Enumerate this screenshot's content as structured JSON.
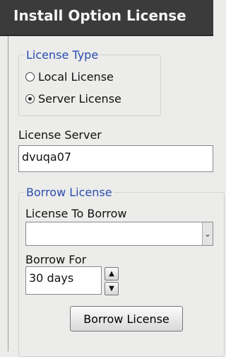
{
  "window": {
    "title": "Install Option License"
  },
  "license_type": {
    "legend": "License Type",
    "options": [
      {
        "label": "Local License",
        "selected": false
      },
      {
        "label": "Server License",
        "selected": true
      }
    ]
  },
  "license_server": {
    "label": "License Server",
    "value": "dvuqa07"
  },
  "borrow": {
    "legend": "Borrow License",
    "license_to_borrow_label": "License To Borrow",
    "license_to_borrow_value": "",
    "borrow_for_label": "Borrow For",
    "borrow_for_value": "30 days",
    "borrow_button_label": "Borrow License"
  },
  "colors": {
    "titlebar": "#3b3b3b",
    "legend_text": "#2a4db0",
    "background": "#ececea"
  }
}
